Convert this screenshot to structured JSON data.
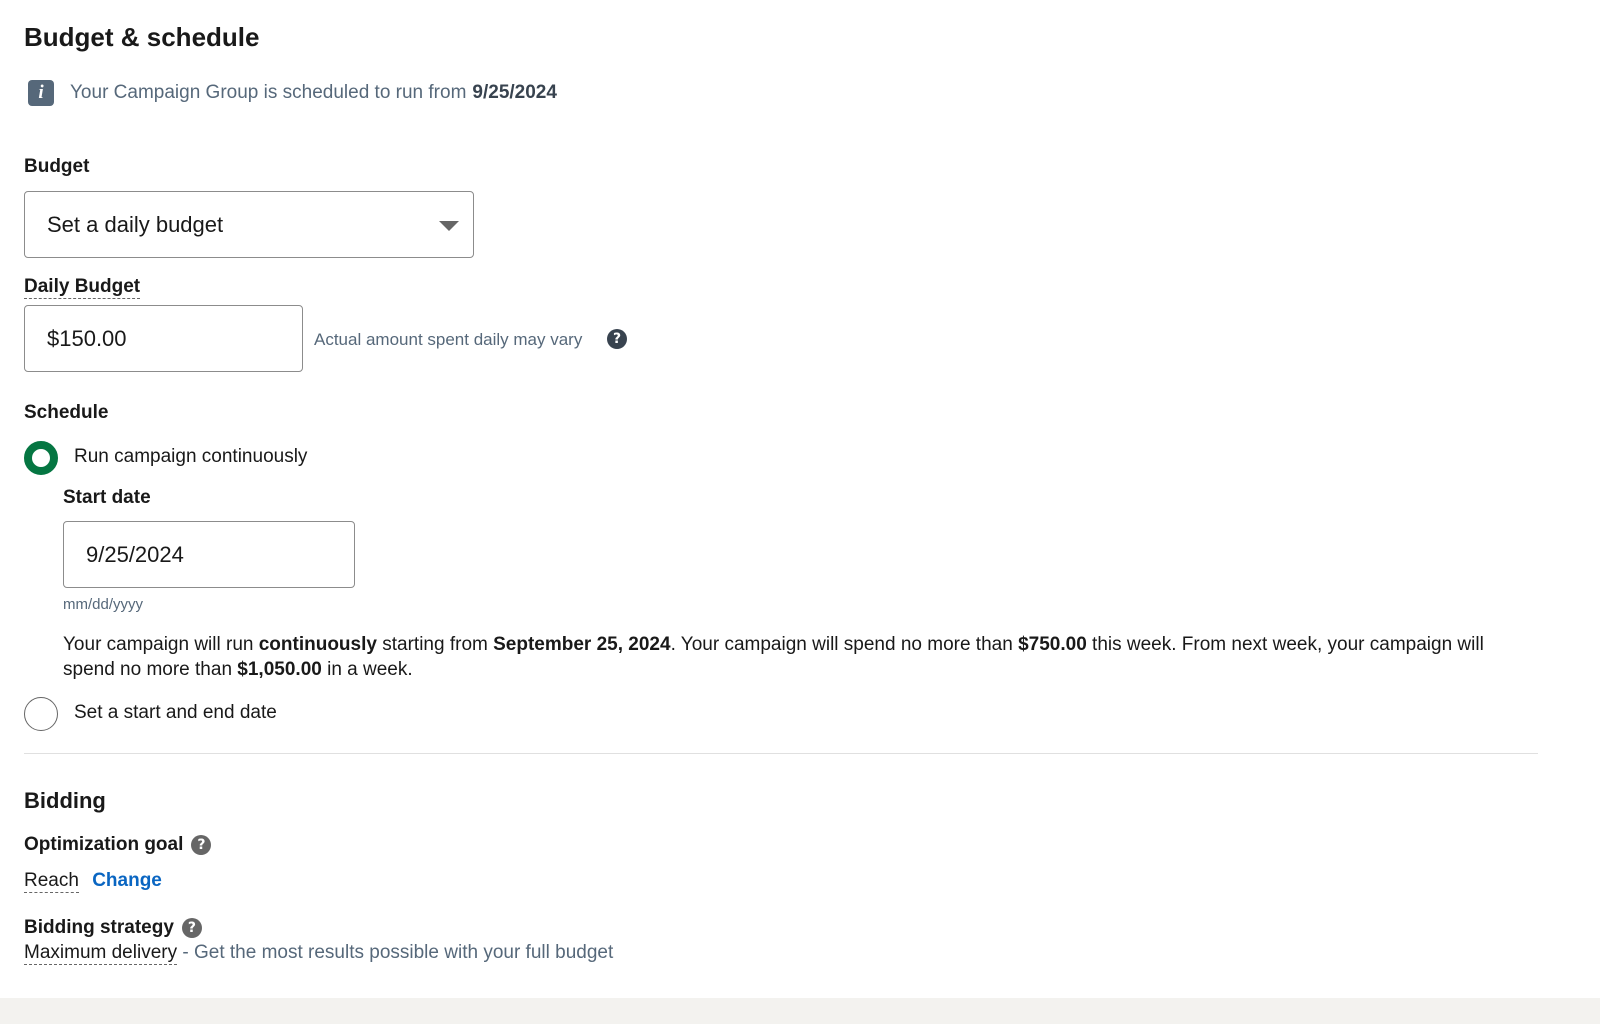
{
  "section": {
    "title": "Budget & schedule"
  },
  "info": {
    "icon": "info-icon",
    "icon_glyph": "i",
    "text": "Your Campaign Group is scheduled to run from",
    "date": "9/25/2024"
  },
  "budget": {
    "label": "Budget",
    "selected": "Set a daily budget",
    "daily_label": "Daily Budget",
    "daily_value": "$150.00",
    "helper": "Actual amount spent daily may vary"
  },
  "schedule": {
    "label": "Schedule",
    "option_continuous": "Run campaign continuously",
    "option_continuous_checked": true,
    "start_label": "Start date",
    "start_value": "9/25/2024",
    "date_format": "mm/dd/yyyy",
    "summary": {
      "p1": "Your campaign will run ",
      "b1": "continuously",
      "p2": " starting from ",
      "b2": "September 25, 2024",
      "p3": ". Your campaign will spend no more than ",
      "b3": "$750.00",
      "p4": " this week. From next week, your campaign will spend no more than ",
      "b4": "$1,050.00",
      "p5": " in a week."
    },
    "option_range": "Set a start and end date",
    "option_range_checked": false
  },
  "bidding": {
    "title": "Bidding",
    "goal_label": "Optimization goal",
    "goal_value": "Reach",
    "change_link": "Change",
    "strategy_label": "Bidding strategy",
    "strategy_value": "Maximum delivery",
    "strategy_desc": " - Get the most results possible with your full budget"
  },
  "icons": {
    "help": "?",
    "accent_color": "#057642",
    "link_color": "#0a66c2"
  }
}
